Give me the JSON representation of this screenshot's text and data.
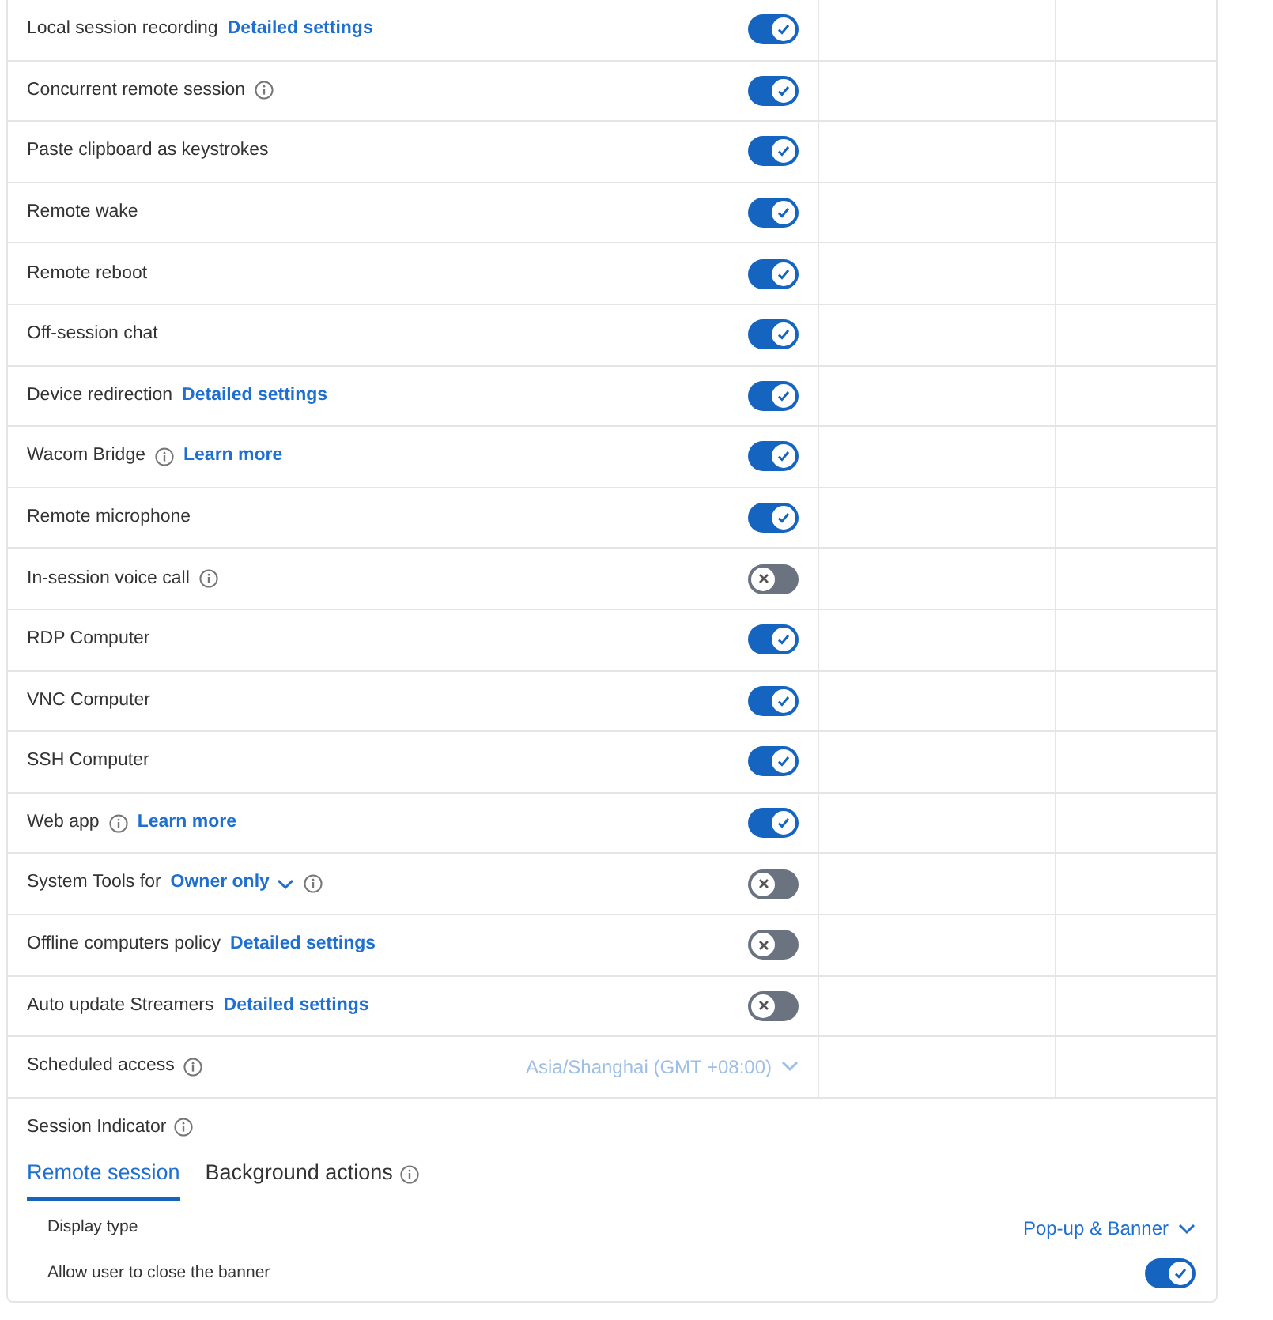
{
  "rows": [
    {
      "parts": [
        {
          "kind": "text",
          "text": "Local session recording"
        },
        {
          "kind": "link",
          "text": "Detailed settings"
        }
      ],
      "control": {
        "kind": "toggle",
        "on": true
      }
    },
    {
      "parts": [
        {
          "kind": "text",
          "text": "Concurrent remote session"
        },
        {
          "kind": "info"
        }
      ],
      "control": {
        "kind": "toggle",
        "on": true
      }
    },
    {
      "parts": [
        {
          "kind": "text",
          "text": "Paste clipboard as keystrokes"
        }
      ],
      "control": {
        "kind": "toggle",
        "on": true
      }
    },
    {
      "parts": [
        {
          "kind": "text",
          "text": "Remote wake"
        }
      ],
      "control": {
        "kind": "toggle",
        "on": true
      }
    },
    {
      "parts": [
        {
          "kind": "text",
          "text": "Remote reboot"
        }
      ],
      "control": {
        "kind": "toggle",
        "on": true
      }
    },
    {
      "parts": [
        {
          "kind": "text",
          "text": "Off-session chat"
        }
      ],
      "control": {
        "kind": "toggle",
        "on": true
      }
    },
    {
      "parts": [
        {
          "kind": "text",
          "text": "Device redirection"
        },
        {
          "kind": "link",
          "text": "Detailed settings"
        }
      ],
      "control": {
        "kind": "toggle",
        "on": true
      }
    },
    {
      "parts": [
        {
          "kind": "text",
          "text": "Wacom Bridge"
        },
        {
          "kind": "info"
        },
        {
          "kind": "link",
          "text": "Learn more"
        }
      ],
      "control": {
        "kind": "toggle",
        "on": true
      }
    },
    {
      "parts": [
        {
          "kind": "text",
          "text": "Remote microphone"
        }
      ],
      "control": {
        "kind": "toggle",
        "on": true
      }
    },
    {
      "parts": [
        {
          "kind": "text",
          "text": "In-session voice call"
        },
        {
          "kind": "info"
        }
      ],
      "control": {
        "kind": "toggle",
        "on": false
      }
    },
    {
      "parts": [
        {
          "kind": "text",
          "text": "RDP Computer"
        }
      ],
      "control": {
        "kind": "toggle",
        "on": true
      }
    },
    {
      "parts": [
        {
          "kind": "text",
          "text": "VNC Computer"
        }
      ],
      "control": {
        "kind": "toggle",
        "on": true
      }
    },
    {
      "parts": [
        {
          "kind": "text",
          "text": "SSH Computer"
        }
      ],
      "control": {
        "kind": "toggle",
        "on": true
      }
    },
    {
      "parts": [
        {
          "kind": "text",
          "text": "Web app"
        },
        {
          "kind": "info"
        },
        {
          "kind": "link",
          "text": "Learn more"
        }
      ],
      "control": {
        "kind": "toggle",
        "on": true
      }
    },
    {
      "parts": [
        {
          "kind": "text",
          "text": "System Tools for"
        },
        {
          "kind": "dropdown",
          "text": "Owner only"
        },
        {
          "kind": "info"
        }
      ],
      "control": {
        "kind": "toggle",
        "on": false
      }
    },
    {
      "parts": [
        {
          "kind": "text",
          "text": "Offline computers policy"
        },
        {
          "kind": "link",
          "text": "Detailed settings"
        }
      ],
      "control": {
        "kind": "toggle",
        "on": false
      }
    },
    {
      "parts": [
        {
          "kind": "text",
          "text": "Auto update Streamers"
        },
        {
          "kind": "link",
          "text": "Detailed settings"
        }
      ],
      "control": {
        "kind": "toggle",
        "on": false
      }
    },
    {
      "parts": [
        {
          "kind": "text",
          "text": "Scheduled access"
        },
        {
          "kind": "info"
        }
      ],
      "control": {
        "kind": "select",
        "value": "Asia/Shanghai (GMT +08:00)",
        "disabled": true
      }
    }
  ],
  "session_indicator": {
    "title": "Session Indicator",
    "tabs": [
      {
        "label": "Remote session",
        "selected": true,
        "info": false
      },
      {
        "label": "Background actions",
        "selected": false,
        "info": true
      }
    ],
    "settings": [
      {
        "label": "Display type",
        "control": {
          "kind": "select",
          "value": "Pop-up & Banner",
          "disabled": false
        }
      },
      {
        "label": "Allow user to close the banner",
        "control": {
          "kind": "toggle",
          "on": true
        }
      }
    ]
  }
}
